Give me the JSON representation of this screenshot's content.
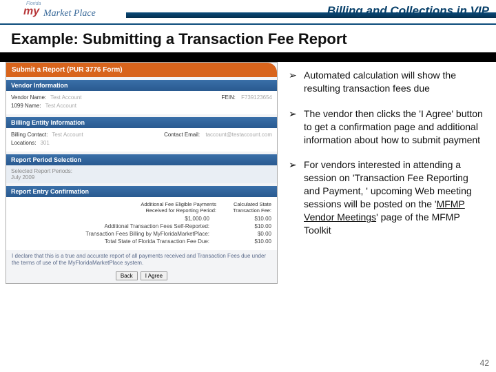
{
  "header": {
    "logo_state": "Florida",
    "logo_my": "my",
    "logo_marketplace": "Market Place",
    "title": "Billing and Collections in VIP"
  },
  "page_title": "Example:  Submitting a Transaction Fee Report",
  "form": {
    "header": "Submit a Report (PUR 3776 Form)",
    "vendor_section": "Vendor Information",
    "vendor_name_label": "Vendor Name:",
    "vendor_name": "Test Account",
    "fein_label": "FEIN:",
    "fein": "F739123654",
    "ten99_label": "1099 Name:",
    "ten99": "Test Account",
    "billing_section": "Billing Entity Information",
    "billing_contact_label": "Billing Contact:",
    "billing_contact": "Test Account",
    "contact_email_label": "Contact Email:",
    "contact_email": "taccount@testaccount.com",
    "locations_label": "Locations:",
    "locations": "301",
    "period_section": "Report Period Selection",
    "period_label": "Selected Report Periods:",
    "period_value": "July 2009",
    "conf_section": "Report Entry Confirmation",
    "conf_h1": "Additional Fee Eligible Payments\nReceived for Reporting Period:",
    "conf_h2": "Calculated State\nTransaction Fee:",
    "row1_val1": "$1,000.00",
    "row1_val2": "$10.00",
    "row2_label": "Additional Transaction Fees Self-Reported:",
    "row2_val": "$10.00",
    "row3_label": "Transaction Fees Billing by MyFloridaMarketPlace:",
    "row3_val": "$0.00",
    "row4_label": "Total State of Florida Transaction Fee Due:",
    "row4_val": "$10.00",
    "declare": "I declare that this is a true and accurate report of all payments received and Transaction Fees due under the terms of use of the MyFloridaMarketPlace system.",
    "btn_back": "Back",
    "btn_agree": "I Agree"
  },
  "bullets": [
    "Automated calculation will show the resulting transaction fees due",
    "The vendor then clicks the 'I Agree' button to get a confirmation page and additional information about how to submit payment",
    "For vendors interested in attending a session on 'Transaction Fee Reporting and Payment, ' upcoming Web meeting sessions will be posted on the '___LINK___' page of the MFMP Toolkit"
  ],
  "link_text": "MFMP Vendor Meetings",
  "page_number": "42"
}
